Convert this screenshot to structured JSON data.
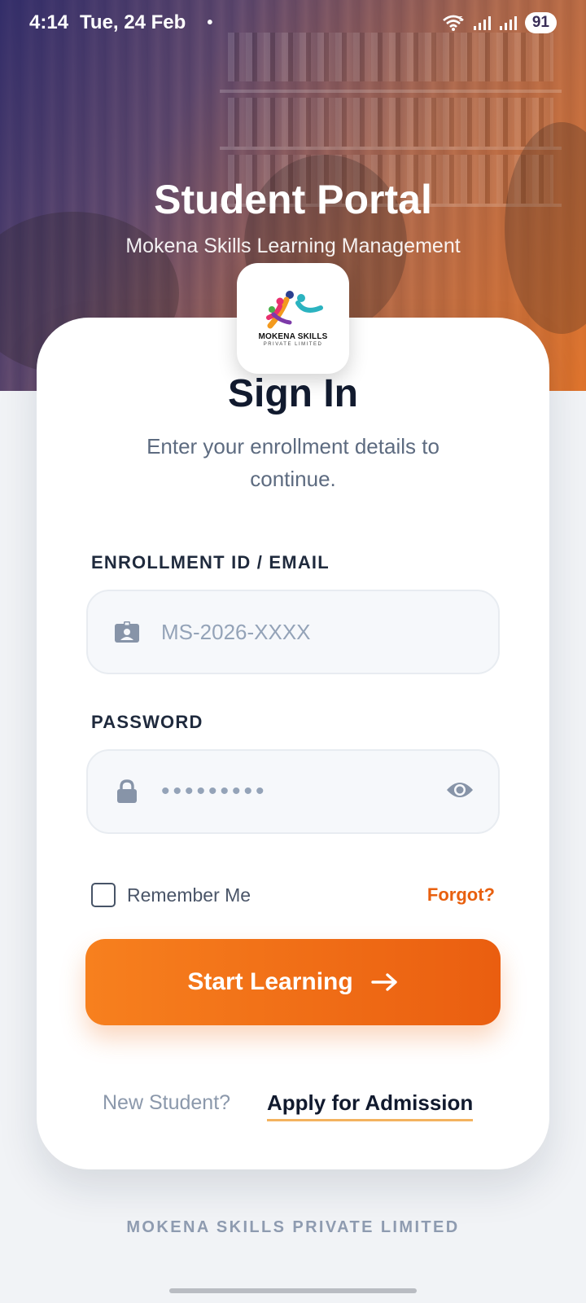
{
  "status_bar": {
    "time": "4:14",
    "date": "Tue, 24 Feb",
    "dot": "•",
    "battery": "91"
  },
  "hero": {
    "title": "Student Portal",
    "subtitle": "Mokena Skills Learning Management"
  },
  "logo": {
    "name": "MOKENA SKILLS",
    "tagline": "PRIVATE LIMITED"
  },
  "signin": {
    "title": "Sign In",
    "description": "Enter your enrollment details to continue."
  },
  "form": {
    "enrollment_label": "ENROLLMENT ID / EMAIL",
    "enrollment_placeholder": "MS-2026-XXXX",
    "password_label": "PASSWORD",
    "password_masked": "•••••••••",
    "remember_label": "Remember Me",
    "remember_checked": false,
    "forgot_label": "Forgot?"
  },
  "cta": {
    "label": "Start Learning"
  },
  "signup": {
    "prompt": "New Student?",
    "link": "Apply for Admission"
  },
  "footer": {
    "company": "MOKENA SKILLS PRIVATE LIMITED"
  },
  "colors": {
    "accent": "#ea5e10",
    "accent_light": "#f7801e",
    "link_underline": "#f4b35f",
    "heading": "#111a2e",
    "muted": "#8b98ab"
  },
  "icons": {
    "enrollment": "id-card-icon",
    "password": "lock-icon",
    "visibility": "eye-icon",
    "cta": "arrow-right-icon"
  }
}
